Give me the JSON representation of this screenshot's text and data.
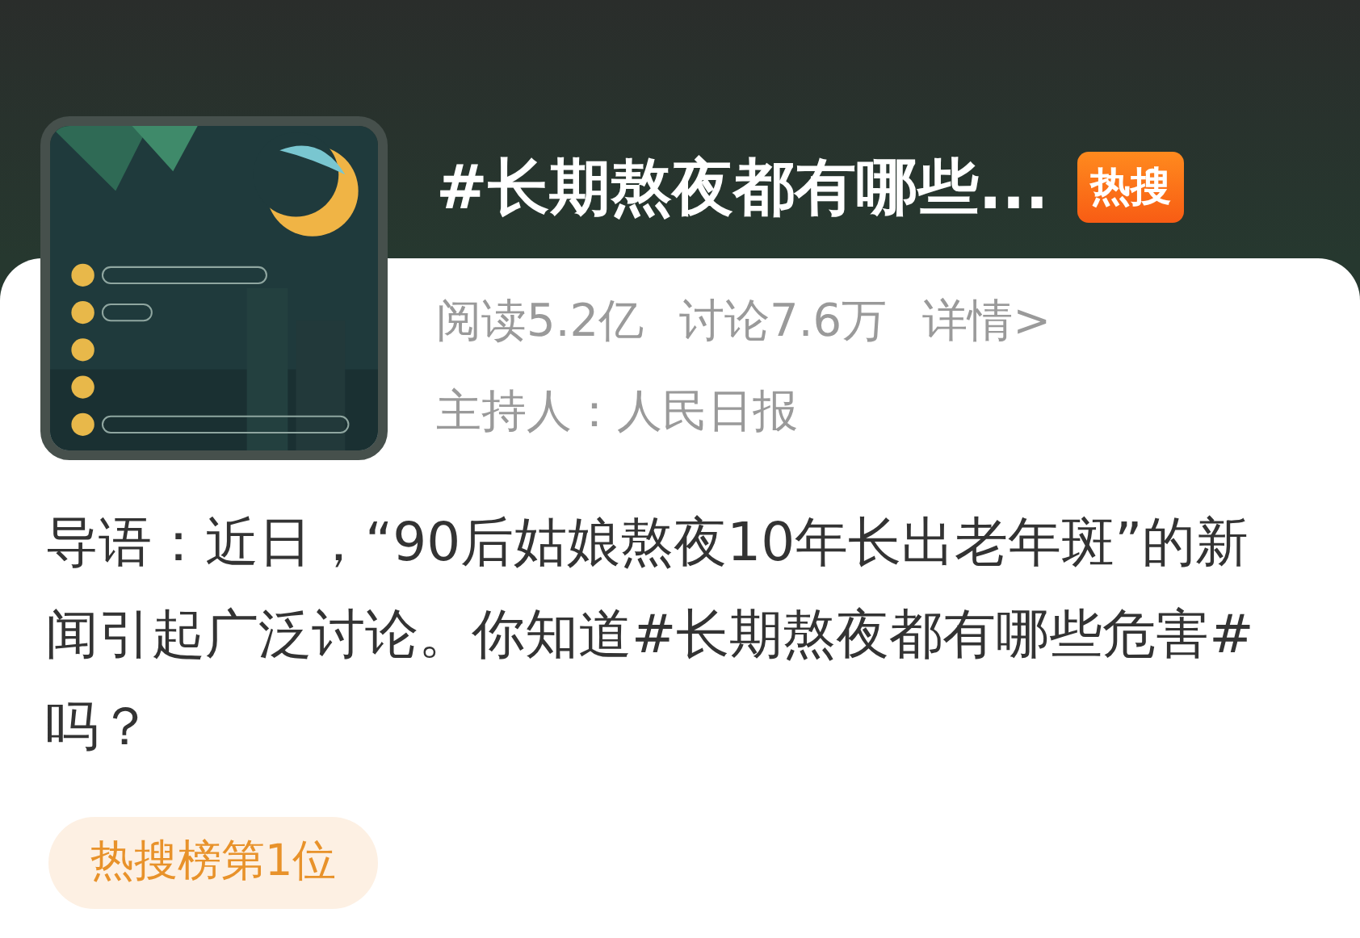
{
  "topic": {
    "title": "#长期熬夜都有哪些...",
    "badge": "热搜",
    "stats": [
      "阅读5.2亿",
      "讨论7.6万",
      "详情>"
    ],
    "host": "主持人：人民日报"
  },
  "intro": "导语：近日，“90后姑娘熬夜10年长出老年斑”的新闻引起广泛讨论。你知道#长期熬夜都有哪些危害#吗？",
  "rank_tag": "热搜榜第1位"
}
